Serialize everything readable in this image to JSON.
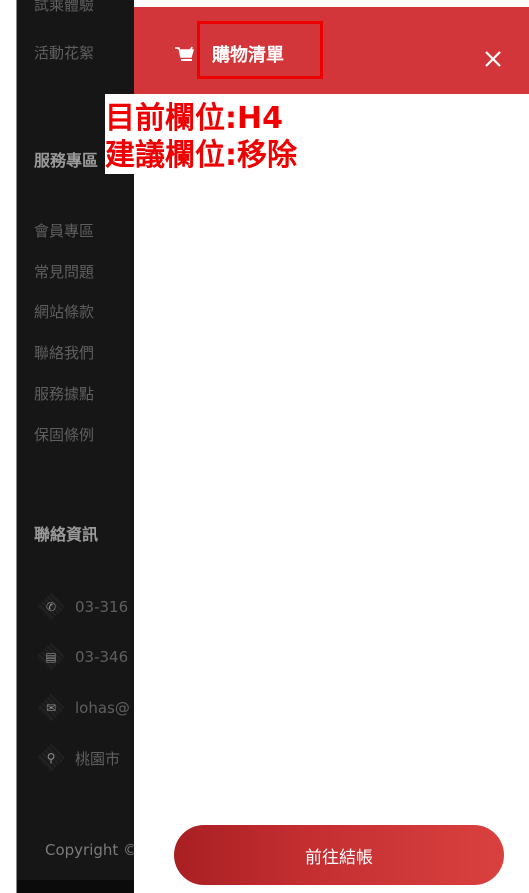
{
  "sidebar": {
    "top_links": [
      "試乘體驗",
      "活動花絮"
    ],
    "service_heading": "服務專區",
    "service_links": [
      "會員專區",
      "常見問題",
      "網站條款",
      "聯絡我們",
      "服務據點",
      "保固條例"
    ],
    "contact_heading": "聯絡資訊",
    "contacts": [
      {
        "icon": "phone-icon",
        "glyph": "✆",
        "text": "03-316"
      },
      {
        "icon": "fax-icon",
        "glyph": "▤",
        "text": "03-346"
      },
      {
        "icon": "mail-icon",
        "glyph": "✉",
        "text": "lohas@"
      },
      {
        "icon": "location-pin-icon",
        "glyph": "⚲",
        "text": "桃園市"
      }
    ],
    "copyright": "Copyright ©"
  },
  "drawer": {
    "title": "購物清單",
    "cart_icon": "cart-icon",
    "close_icon": "close-icon",
    "annotation": {
      "current_field": "目前欄位:H4",
      "suggested_field": "建議欄位:移除"
    },
    "checkout_label": "前往結帳",
    "accent_color": "#d3363a",
    "annotation_color": "#ee0000"
  }
}
